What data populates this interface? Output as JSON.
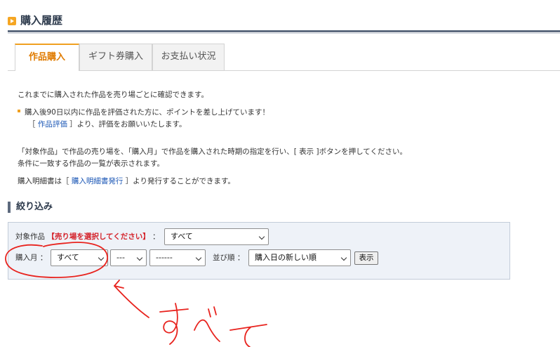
{
  "header": {
    "title": "購入履歴",
    "icon": "play-square-icon",
    "accent": "#f5a623"
  },
  "tabs": [
    {
      "label": "作品購入",
      "active": true
    },
    {
      "label": "ギフト券購入",
      "active": false
    },
    {
      "label": "お支払い状況",
      "active": false
    }
  ],
  "content": {
    "intro": "これまでに購入された作品を売り場ごとに確認できます。",
    "promo_line1": "購入後90日以内に作品を評価された方に、ポイントを差し上げています！",
    "promo_line2_prefix": "［ ",
    "promo_line2_link": "作品評価",
    "promo_line2_suffix": " ］より、評価をお願いいたします。",
    "instruction_line1": "「対象作品」で作品の売り場を、「購入月」で作品を購入された時期の指定を行い、[ 表示 ]ボタンを押してください。",
    "instruction_line2": "条件に一致する作品の一覧が表示されます。",
    "receipt_prefix": "購入明細書は［ ",
    "receipt_link": "購入明細書発行",
    "receipt_suffix": " ］より発行することができます。"
  },
  "filter": {
    "title": "絞り込み",
    "target_label": "対象作品",
    "target_hint": "【売り場を選択してください】",
    "colon": "：",
    "target_value": "すべて",
    "month_label": "購入月",
    "month_value": "すべて",
    "month_mm_value": "---",
    "month_dd_value": "------",
    "sort_label": "並び順",
    "sort_value": "購入日の新しい順",
    "show_button": "表示"
  },
  "annotation": {
    "handwritten_text": "すべて",
    "color": "#e8231e"
  }
}
